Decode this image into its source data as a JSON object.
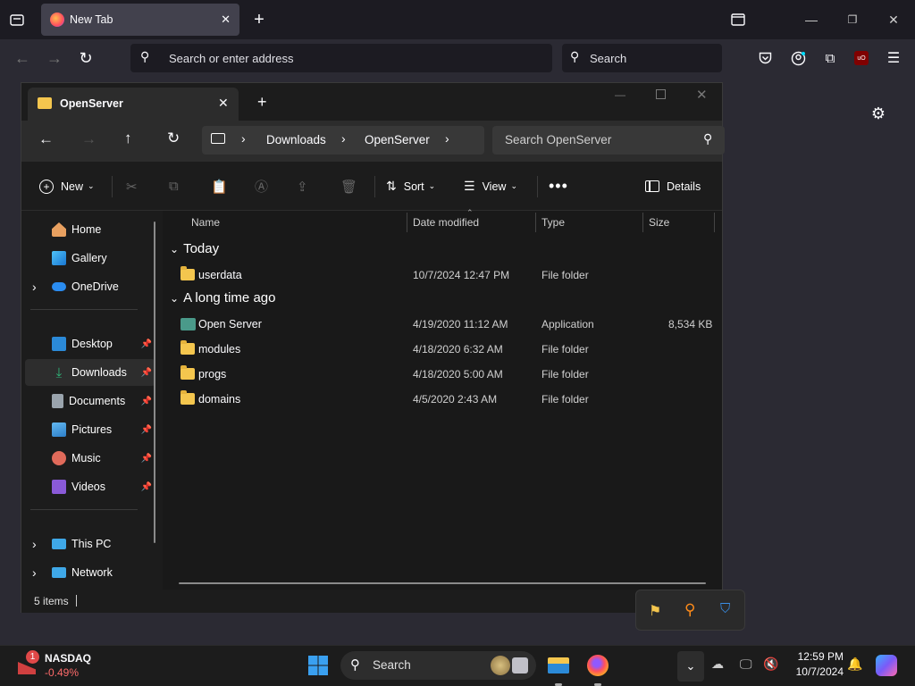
{
  "firefox": {
    "tab_title": "New Tab",
    "url_placeholder": "Search or enter address",
    "search_placeholder": "Search"
  },
  "explorer": {
    "tab_title": "OpenServer",
    "breadcrumb": [
      "Downloads",
      "OpenServer"
    ],
    "search_placeholder": "Search OpenServer",
    "commands": {
      "new": "New",
      "sort": "Sort",
      "view": "View",
      "details": "Details"
    },
    "sidebar": {
      "quick": [
        {
          "label": "Home",
          "icon": "home-icon"
        },
        {
          "label": "Gallery",
          "icon": "gallery-icon"
        },
        {
          "label": "OneDrive",
          "icon": "cloud-icon"
        }
      ],
      "pinned": [
        {
          "label": "Desktop",
          "icon": "desktop-icon"
        },
        {
          "label": "Downloads",
          "icon": "download-icon"
        },
        {
          "label": "Documents",
          "icon": "document-icon"
        },
        {
          "label": "Pictures",
          "icon": "picture-icon"
        },
        {
          "label": "Music",
          "icon": "music-icon"
        },
        {
          "label": "Videos",
          "icon": "video-icon"
        }
      ],
      "devices": [
        {
          "label": "This PC",
          "icon": "computer-icon"
        },
        {
          "label": "Network",
          "icon": "network-icon"
        }
      ]
    },
    "columns": [
      "Name",
      "Date modified",
      "Type",
      "Size"
    ],
    "groups": [
      {
        "label": "Today",
        "files": [
          {
            "name": "userdata",
            "date": "10/7/2024 12:47 PM",
            "type": "File folder",
            "size": ""
          }
        ]
      },
      {
        "label": "A long time ago",
        "files": [
          {
            "name": "Open Server",
            "date": "4/19/2020 11:12 AM",
            "type": "Application",
            "size": "8,534 KB"
          },
          {
            "name": "modules",
            "date": "4/18/2020 6:32 AM",
            "type": "File folder",
            "size": ""
          },
          {
            "name": "progs",
            "date": "4/18/2020 5:00 AM",
            "type": "File folder",
            "size": ""
          },
          {
            "name": "domains",
            "date": "4/5/2020 2:43 AM",
            "type": "File folder",
            "size": ""
          }
        ]
      }
    ],
    "status": "5 items"
  },
  "taskbar": {
    "stock_name": "NASDAQ",
    "stock_change": "-0.49%",
    "stock_badge": "1",
    "search_label": "Search",
    "time": "12:59 PM",
    "date": "10/7/2024"
  },
  "colors": {
    "accent": "#0078d4",
    "folder": "#f4c64e",
    "stock_down": "#ff6b6b"
  }
}
